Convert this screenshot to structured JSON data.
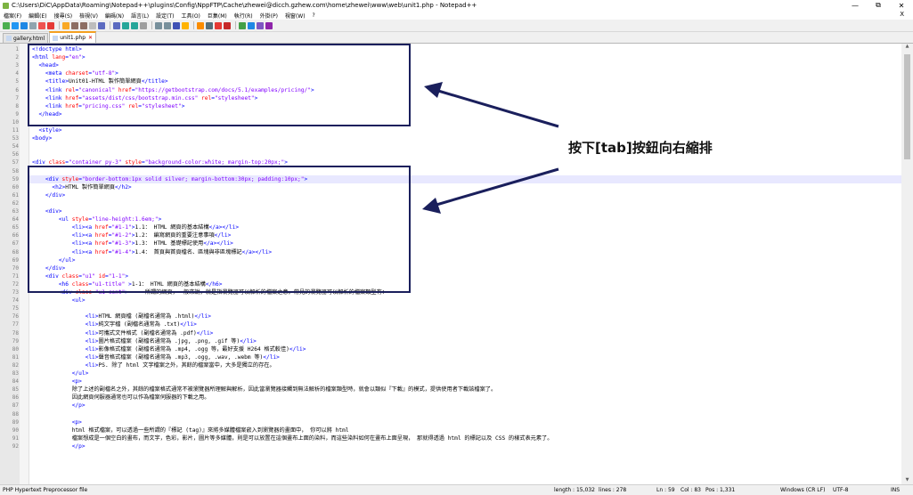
{
  "window": {
    "title": "C:\\Users\\DiC\\AppData\\Roaming\\Notepad++\\plugins\\Config\\NppFTP\\Cache\\zhewei@dicch.gzhew.com\\home\\zhewei\\www\\web\\unit1.php - Notepad++",
    "minimize": "—",
    "restore": "⧉",
    "close": "✕"
  },
  "menu": [
    "檔案(F)",
    "編輯(E)",
    "搜尋(S)",
    "檢視(V)",
    "編碼(N)",
    "語言(L)",
    "設定(T)",
    "工具(O)",
    "巨集(M)",
    "執行(R)",
    "外掛(P)",
    "視窗(W)",
    "?"
  ],
  "menu_close": "X",
  "tabs": [
    {
      "label": "gallery.html",
      "active": false
    },
    {
      "label": "unit1.php",
      "active": true
    }
  ],
  "annotation": "按下[tab]按鈕向右縮排",
  "colors": {
    "box": "#1a1f5c",
    "arrow": "#1a1f5c",
    "tag": "#0000ff",
    "attr": "#ff0000",
    "value": "#8000ff"
  },
  "lines": [
    {
      "n": "1",
      "segs": [
        [
          "tag",
          "<!doctype html>"
        ]
      ]
    },
    {
      "n": "2",
      "segs": [
        [
          "tag",
          "<html "
        ],
        [
          "attr",
          "lang"
        ],
        [
          "tag",
          "="
        ],
        [
          "val",
          "\"en\""
        ],
        [
          "tag",
          ">"
        ]
      ]
    },
    {
      "n": "3",
      "segs": [
        [
          "txt",
          "  "
        ],
        [
          "tag",
          "<head>"
        ]
      ]
    },
    {
      "n": "4",
      "segs": [
        [
          "txt",
          "    "
        ],
        [
          "tag",
          "<meta "
        ],
        [
          "attr",
          "charset"
        ],
        [
          "tag",
          "="
        ],
        [
          "val",
          "\"utf-8\""
        ],
        [
          "tag",
          ">"
        ]
      ]
    },
    {
      "n": "5",
      "segs": [
        [
          "txt",
          "    "
        ],
        [
          "tag",
          "<title>"
        ],
        [
          "txt",
          "Unit01-HTML 製作簡單網頁"
        ],
        [
          "tag",
          "</title>"
        ]
      ]
    },
    {
      "n": "6",
      "segs": [
        [
          "txt",
          "    "
        ],
        [
          "tag",
          "<link "
        ],
        [
          "attr",
          "rel"
        ],
        [
          "tag",
          "="
        ],
        [
          "val",
          "\"canonical\""
        ],
        [
          "tag",
          " "
        ],
        [
          "attr",
          "href"
        ],
        [
          "tag",
          "="
        ],
        [
          "val",
          "\"https://getbootstrap.com/docs/5.1/examples/pricing/\""
        ],
        [
          "tag",
          ">"
        ]
      ]
    },
    {
      "n": "7",
      "segs": [
        [
          "txt",
          "    "
        ],
        [
          "tag",
          "<link "
        ],
        [
          "attr",
          "href"
        ],
        [
          "tag",
          "="
        ],
        [
          "val",
          "\"assets/dist/css/bootstrap.min.css\""
        ],
        [
          "tag",
          " "
        ],
        [
          "attr",
          "rel"
        ],
        [
          "tag",
          "="
        ],
        [
          "val",
          "\"stylesheet\""
        ],
        [
          "tag",
          ">"
        ]
      ]
    },
    {
      "n": "8",
      "segs": [
        [
          "txt",
          "    "
        ],
        [
          "tag",
          "<link "
        ],
        [
          "attr",
          "href"
        ],
        [
          "tag",
          "="
        ],
        [
          "val",
          "\"pricing.css\""
        ],
        [
          "tag",
          " "
        ],
        [
          "attr",
          "rel"
        ],
        [
          "tag",
          "="
        ],
        [
          "val",
          "\"stylesheet\""
        ],
        [
          "tag",
          ">"
        ]
      ]
    },
    {
      "n": "9",
      "segs": [
        [
          "txt",
          "  "
        ],
        [
          "tag",
          "</head>"
        ]
      ]
    },
    {
      "n": "10",
      "segs": []
    },
    {
      "n": "11",
      "segs": [
        [
          "txt",
          "  "
        ],
        [
          "tag",
          "<style>"
        ]
      ]
    },
    {
      "n": "53",
      "segs": [
        [
          "tag",
          "<body>"
        ]
      ]
    },
    {
      "n": "54",
      "segs": []
    },
    {
      "n": "56",
      "segs": []
    },
    {
      "n": "57",
      "segs": [
        [
          "tag",
          "<div "
        ],
        [
          "attr",
          "class"
        ],
        [
          "tag",
          "="
        ],
        [
          "val",
          "\"container py-3\""
        ],
        [
          "tag",
          " "
        ],
        [
          "attr",
          "style"
        ],
        [
          "tag",
          "="
        ],
        [
          "val",
          "\"background-color:white; margin-top:20px;\""
        ],
        [
          "tag",
          ">"
        ]
      ]
    },
    {
      "n": "58",
      "segs": []
    },
    {
      "n": "59",
      "segs": [
        [
          "txt",
          "    "
        ],
        [
          "tag",
          "<div "
        ],
        [
          "attr",
          "style"
        ],
        [
          "tag",
          "="
        ],
        [
          "val",
          "\"border-bottom:1px solid silver; margin-bottom:30px; padding:10px;\""
        ],
        [
          "tag",
          ">"
        ]
      ]
    },
    {
      "n": "60",
      "segs": [
        [
          "txt",
          "      "
        ],
        [
          "tag",
          "<h2>"
        ],
        [
          "txt",
          "HTML 製作簡單網頁"
        ],
        [
          "tag",
          "</h2>"
        ]
      ]
    },
    {
      "n": "61",
      "segs": [
        [
          "txt",
          "    "
        ],
        [
          "tag",
          "</div>"
        ]
      ]
    },
    {
      "n": "62",
      "segs": []
    },
    {
      "n": "63",
      "segs": [
        [
          "txt",
          "    "
        ],
        [
          "tag",
          "<div>"
        ]
      ]
    },
    {
      "n": "64",
      "segs": [
        [
          "txt",
          "        "
        ],
        [
          "tag",
          "<ul "
        ],
        [
          "attr",
          "style"
        ],
        [
          "tag",
          "="
        ],
        [
          "val",
          "\"line-height:1.6em;\""
        ],
        [
          "tag",
          ">"
        ]
      ]
    },
    {
      "n": "65",
      "segs": [
        [
          "txt",
          "            "
        ],
        [
          "tag",
          "<li><a "
        ],
        [
          "attr",
          "href"
        ],
        [
          "tag",
          "="
        ],
        [
          "val",
          "\"#1-1\""
        ],
        [
          "tag",
          ">"
        ],
        [
          "txt",
          "1.1： HTML 網頁的基本結構"
        ],
        [
          "tag",
          "</a></li>"
        ]
      ]
    },
    {
      "n": "66",
      "segs": [
        [
          "txt",
          "            "
        ],
        [
          "tag",
          "<li><a "
        ],
        [
          "attr",
          "href"
        ],
        [
          "tag",
          "="
        ],
        [
          "val",
          "\"#1-2\""
        ],
        [
          "tag",
          ">"
        ],
        [
          "txt",
          "1.2： 編寫網頁的重要注意事項"
        ],
        [
          "tag",
          "</li>"
        ]
      ]
    },
    {
      "n": "67",
      "segs": [
        [
          "txt",
          "            "
        ],
        [
          "tag",
          "<li><a "
        ],
        [
          "attr",
          "href"
        ],
        [
          "tag",
          "="
        ],
        [
          "val",
          "\"#1-3\""
        ],
        [
          "tag",
          ">"
        ],
        [
          "txt",
          "1.3： HTML 基礎標記使用"
        ],
        [
          "tag",
          "</a></li>"
        ]
      ]
    },
    {
      "n": "68",
      "segs": [
        [
          "txt",
          "            "
        ],
        [
          "tag",
          "<li><a "
        ],
        [
          "attr",
          "href"
        ],
        [
          "tag",
          "="
        ],
        [
          "val",
          "\"#1-4\""
        ],
        [
          "tag",
          ">"
        ],
        [
          "txt",
          "1.4： 首頁與首頁檔名、區塊與非區塊標記"
        ],
        [
          "tag",
          "</a></li>"
        ]
      ]
    },
    {
      "n": "69",
      "segs": [
        [
          "txt",
          "        "
        ],
        [
          "tag",
          "</ul>"
        ]
      ]
    },
    {
      "n": "70",
      "segs": [
        [
          "txt",
          "    "
        ],
        [
          "tag",
          "</div>"
        ]
      ]
    },
    {
      "n": "71",
      "segs": [
        [
          "txt",
          "    "
        ],
        [
          "tag",
          "<div "
        ],
        [
          "attr",
          "class"
        ],
        [
          "tag",
          "="
        ],
        [
          "val",
          "\"u1\""
        ],
        [
          "tag",
          " "
        ],
        [
          "attr",
          "id"
        ],
        [
          "tag",
          "="
        ],
        [
          "val",
          "\"1-1\""
        ],
        [
          "tag",
          ">"
        ]
      ]
    },
    {
      "n": "72",
      "segs": [
        [
          "txt",
          "        "
        ],
        [
          "tag",
          "<h6 "
        ],
        [
          "attr",
          "class"
        ],
        [
          "tag",
          "="
        ],
        [
          "val",
          "\"u1-title\""
        ],
        [
          "tag",
          " >"
        ],
        [
          "txt",
          "1-1： HTML 網頁的基本結構"
        ],
        [
          "tag",
          "</h6>"
        ]
      ]
    },
    {
      "n": "73",
      "segs": [
        [
          "txt",
          "        "
        ],
        [
          "tag",
          "<div "
        ],
        [
          "attr",
          "class"
        ],
        [
          "tag",
          "="
        ],
        [
          "val",
          "\"u1-cont\""
        ],
        [
          "tag",
          ">"
        ],
        [
          "txt",
          "     所謂的網頁，一般來說，就是指瀏覽器可以解析的檔案之意。常見的瀏覽器可以解析的檔案類型有："
        ]
      ]
    },
    {
      "n": "74",
      "segs": [
        [
          "txt",
          "            "
        ],
        [
          "tag",
          "<ul>"
        ]
      ]
    },
    {
      "n": "75",
      "segs": []
    },
    {
      "n": "76",
      "segs": [
        [
          "txt",
          "                "
        ],
        [
          "tag",
          "<li>"
        ],
        [
          "txt",
          "HTML 網頁檔 (副檔名通常為 .html)"
        ],
        [
          "tag",
          "</li>"
        ]
      ]
    },
    {
      "n": "77",
      "segs": [
        [
          "txt",
          "                "
        ],
        [
          "tag",
          "<li>"
        ],
        [
          "txt",
          "純文字檔 (副檔名通常為 .txt)"
        ],
        [
          "tag",
          "</li>"
        ]
      ]
    },
    {
      "n": "78",
      "segs": [
        [
          "txt",
          "                "
        ],
        [
          "tag",
          "<li>"
        ],
        [
          "txt",
          "可攜式文件格式 (副檔名通常為 .pdf)"
        ],
        [
          "tag",
          "</li>"
        ]
      ]
    },
    {
      "n": "79",
      "segs": [
        [
          "txt",
          "                "
        ],
        [
          "tag",
          "<li>"
        ],
        [
          "txt",
          "圖片格式檔案 (副檔名通常為 .jpg, .png, .gif 等)"
        ],
        [
          "tag",
          "</li>"
        ]
      ]
    },
    {
      "n": "80",
      "segs": [
        [
          "txt",
          "                "
        ],
        [
          "tag",
          "<li>"
        ],
        [
          "txt",
          "影像格式檔案 (副檔名通常為 .mp4, .ogg 等，最好支援 H264 格式較佳)"
        ],
        [
          "tag",
          "</li>"
        ]
      ]
    },
    {
      "n": "81",
      "segs": [
        [
          "txt",
          "                "
        ],
        [
          "tag",
          "<li>"
        ],
        [
          "txt",
          "聲音格式檔案 (副檔名通常為 .mp3, .ogg, .wav, .webm 等)"
        ],
        [
          "tag",
          "</li>"
        ]
      ]
    },
    {
      "n": "82",
      "segs": [
        [
          "txt",
          "                "
        ],
        [
          "tag",
          "<li>"
        ],
        [
          "txt",
          "PS. 除了 html 文字檔案之外，其餘的檔案當中，大多是獨立的存在。"
        ]
      ]
    },
    {
      "n": "83",
      "segs": [
        [
          "txt",
          "            "
        ],
        [
          "tag",
          "</ul>"
        ]
      ]
    },
    {
      "n": "84",
      "segs": [
        [
          "txt",
          "            "
        ],
        [
          "tag",
          "<p>"
        ]
      ]
    },
    {
      "n": "85",
      "segs": [
        [
          "txt",
          "            除了上述的副檔名之外，其餘的檔案格式通常不被瀏覽器所理解與解析，因此當瀏覽器接觸到無法解析的檔案類型時，就會以類似『下載』的模式，提供使用者下載該檔案了。"
        ]
      ]
    },
    {
      "n": "86",
      "segs": [
        [
          "txt",
          "            因此網頁伺服器通常也可以作為檔案伺服器的下載之用。"
        ]
      ]
    },
    {
      "n": "87",
      "segs": [
        [
          "txt",
          "            "
        ],
        [
          "tag",
          "</p>"
        ]
      ]
    },
    {
      "n": "88",
      "segs": []
    },
    {
      "n": "89",
      "segs": [
        [
          "txt",
          "            "
        ],
        [
          "tag",
          "<p>"
        ]
      ]
    },
    {
      "n": "90",
      "segs": [
        [
          "txt",
          "            html 格式檔案，可以透過一些所謂的『標記 (tag)』來將多媒體檔案嵌入到瀏覽器的畫面中， 你可以將 html"
        ]
      ]
    },
    {
      "n": "91",
      "segs": [
        [
          "txt",
          "            檔案想成是一個空白的畫布，而文字，色彩，影片，圖片等多媒體，則是可以放置在這個畫布上面的染料，而這些染料如何在畫布上面呈現， 那就得透過 html 的標記以及 CSS 的樣式表元素了。"
        ]
      ]
    },
    {
      "n": "92",
      "segs": [
        [
          "txt",
          "            "
        ],
        [
          "tag",
          "</p>"
        ]
      ]
    }
  ],
  "status": {
    "lang": "PHP Hypertext Preprocessor file",
    "length": "length : 15,032",
    "lines": "lines : 278",
    "ln": "Ln : 59",
    "col": "Col : 83",
    "pos": "Pos : 1,331",
    "eol": "Windows (CR LF)",
    "enc": "UTF-8",
    "ins": "INS"
  }
}
